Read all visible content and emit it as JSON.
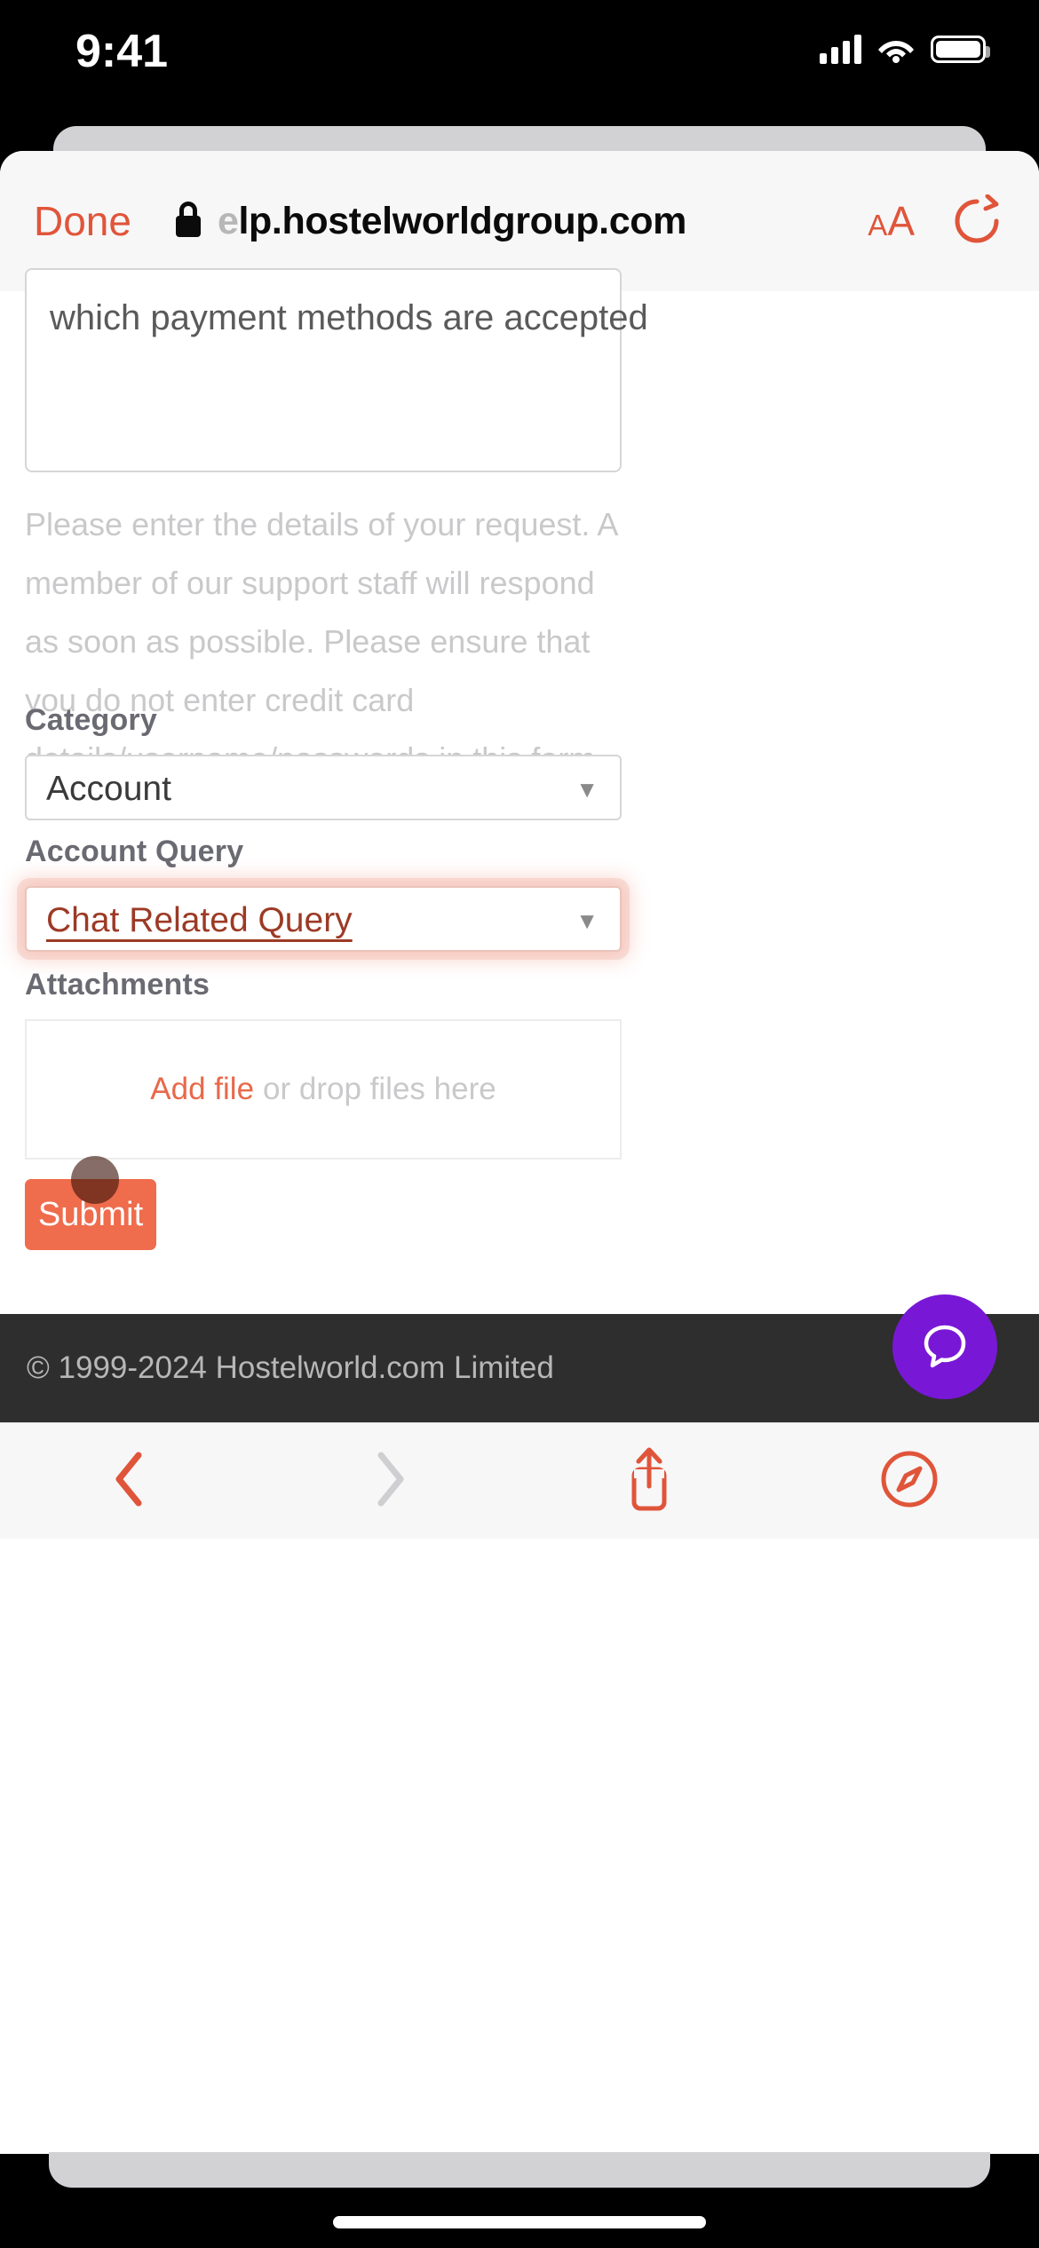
{
  "status_bar": {
    "time": "9:41",
    "signal_icon": "cellular-bars-icon",
    "wifi_icon": "wifi-icon",
    "battery_icon": "battery-icon"
  },
  "browser": {
    "done_label": "Done",
    "lock_icon": "lock-icon",
    "url_faded_prefix": "e",
    "url": "lp.hostelworldgroup.com",
    "text_size_small": "A",
    "text_size_large": "A",
    "reload_icon": "reload-icon",
    "toolbar": {
      "back_icon": "chevron-left-icon",
      "forward_icon": "chevron-right-icon",
      "share_icon": "share-icon",
      "tabs_icon": "compass-icon"
    }
  },
  "form": {
    "description_value": "which payment methods are accepted",
    "description_help": "Please enter the details of your request. A member of our support staff will respond as soon as possible. Please ensure that you do not enter credit card details/username/passwords in this form.",
    "category_label": "Category",
    "category_value": "Account",
    "category_arrow": "▼",
    "account_query_label": "Account Query",
    "account_query_value": "Chat Related Query",
    "account_query_arrow": "▼",
    "attachments_label": "Attachments",
    "add_file_label": "Add file",
    "drop_hint": "or drop files here",
    "submit_label": "Submit"
  },
  "site_footer": {
    "copyright": "© 1999-2024 Hostelworld.com Limited",
    "chat_icon": "chat-bubble-icon"
  },
  "colors": {
    "accent_orange": "#e8694a",
    "safari_tint": "#e0553a",
    "focus_text": "#9c3a25",
    "chat_purple": "#7818d6",
    "footer_dark": "#2e2e2e"
  }
}
